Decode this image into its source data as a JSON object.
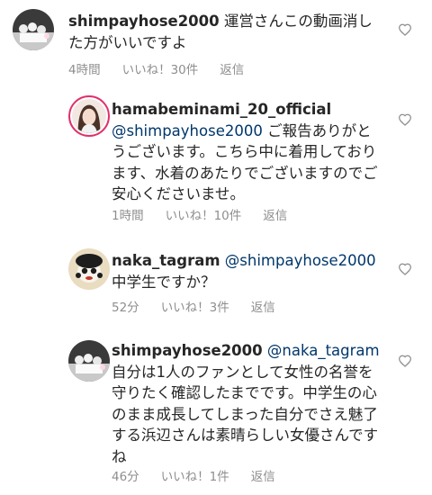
{
  "comments": [
    {
      "username": "shimpayhose2000",
      "mention": "",
      "text": " 運営さんこの動画消した方がいいですよ",
      "time": "4時間",
      "likes": "いいね！30件",
      "reply": "返信",
      "avatar_icon": "group-photo-avatar",
      "heart_icon": "heart-outline-icon"
    },
    {
      "username": "hamabeminami_20_official",
      "mention": "@shimpayhose2000",
      "text": " ご報告ありがとうございます。こちら中に着用しております、水着のあたりでございますのでご安心くださいませ。",
      "time": "1時間",
      "likes": "いいね！10件",
      "reply": "返信",
      "avatar_icon": "profile-photo-avatar",
      "heart_icon": "heart-outline-icon"
    },
    {
      "username": "naka_tagram",
      "mention": "@shimpayhose2000",
      "text": "中学生ですか？",
      "time": "52分",
      "likes": "いいね！3件",
      "reply": "返信",
      "avatar_icon": "cartoon-character-avatar",
      "heart_icon": "heart-outline-icon"
    },
    {
      "username": "shimpayhose2000",
      "mention": "@naka_tagram",
      "text": "自分は1人のファンとして女性の名誉を守りたく確認したまでです。中学生の心のまま成長してしまった自分でさえ魅了する浜辺さんは素晴らしい女優さんですね",
      "time": "46分",
      "likes": "いいね！1件",
      "reply": "返信",
      "avatar_icon": "group-photo-avatar",
      "heart_icon": "heart-outline-icon"
    }
  ],
  "colors": {
    "text": "#262626",
    "mention": "#00376b",
    "meta": "#8e8e8e",
    "story_ring": "#e1306c"
  }
}
